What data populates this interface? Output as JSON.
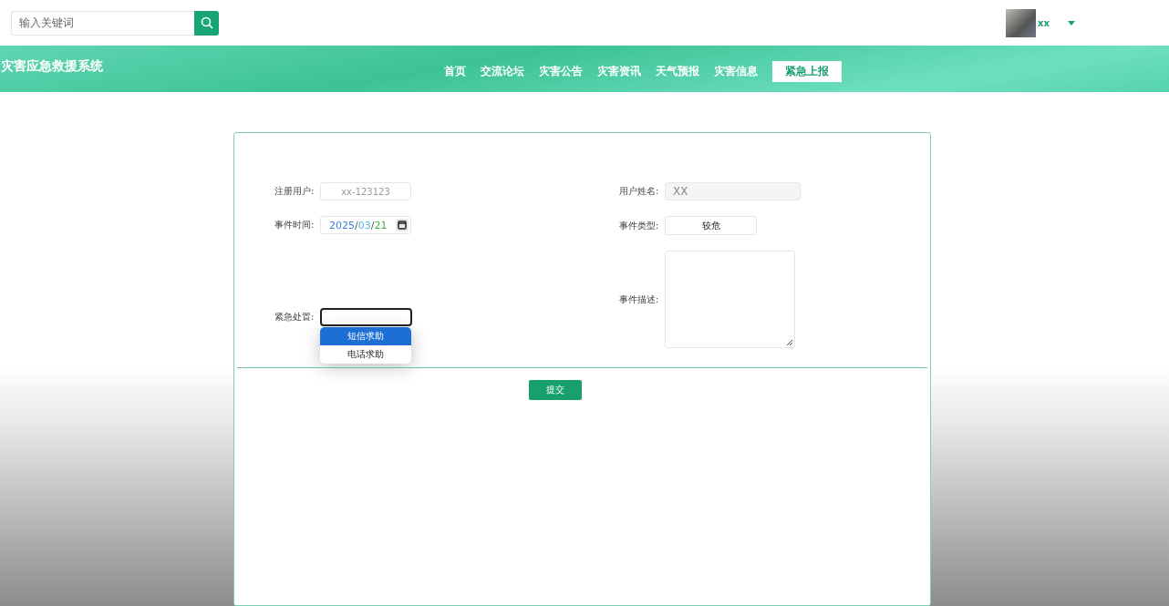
{
  "search": {
    "placeholder": "输入关键词"
  },
  "user": {
    "name": "xx"
  },
  "header": {
    "title": "灾害应急救援系统",
    "nav": [
      {
        "label": "首页",
        "selected": false
      },
      {
        "label": "交流论坛",
        "selected": false
      },
      {
        "label": "灾害公告",
        "selected": false
      },
      {
        "label": "灾害资讯",
        "selected": false
      },
      {
        "label": "天气预报",
        "selected": false
      },
      {
        "label": "灾害信息",
        "selected": false
      },
      {
        "label": "紧急上报",
        "selected": true
      }
    ]
  },
  "form": {
    "left": [
      {
        "kind": "text",
        "label": "注册用户:",
        "value": "xx-123123"
      },
      {
        "kind": "date",
        "label": "事件时间:",
        "separator": "/",
        "parts": [
          {
            "text": "2025",
            "color": "#3b7dd8"
          },
          {
            "text": "03",
            "color": "#4fb8e0"
          },
          {
            "text": "21",
            "color": "#3cb043"
          }
        ]
      },
      {
        "kind": "select",
        "label": "紧急处置:",
        "open": true,
        "options": [
          {
            "label": "短信求助",
            "selected": true
          },
          {
            "label": "电话求助",
            "selected": false
          }
        ]
      }
    ],
    "right": [
      {
        "kind": "text",
        "label": "用户姓名:",
        "value": "XX",
        "disabled": true
      },
      {
        "kind": "select",
        "label": "事件类型:",
        "value": "较危"
      },
      {
        "kind": "textarea",
        "label": "事件描述:"
      }
    ],
    "submit": "提交"
  }
}
